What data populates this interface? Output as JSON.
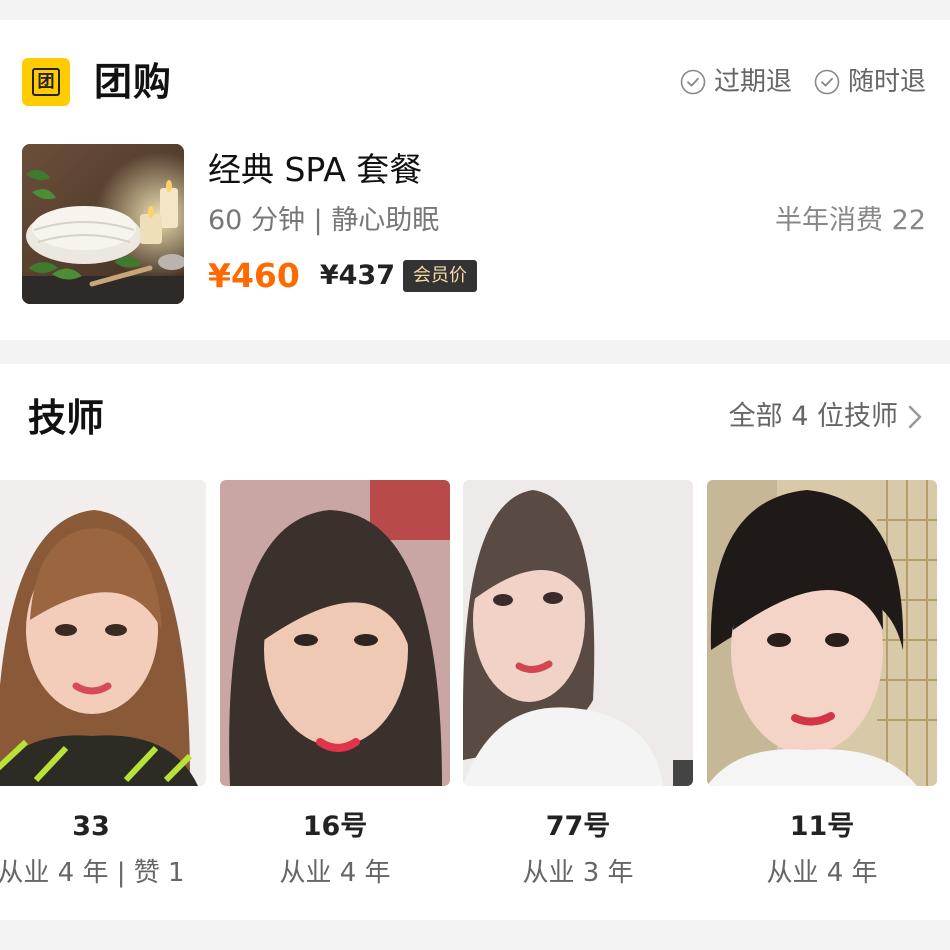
{
  "deal": {
    "logo_char": "团",
    "title": "团购",
    "guarantees": [
      "过期退",
      "随时退"
    ]
  },
  "product": {
    "name": "经典 SPA 套餐",
    "meta": "60 分钟 | 静心助眠",
    "sales": "半年消费 22",
    "price": "¥460",
    "member_price": "¥437",
    "member_label": "会员价"
  },
  "technicians": {
    "title": "技师",
    "all_link": "全部 4 位技师",
    "items": [
      {
        "number": "33",
        "experience": "从业 4 年 | 赞 1"
      },
      {
        "number": "16号",
        "experience": "从业 4 年"
      },
      {
        "number": "77号",
        "experience": "从业 3 年"
      },
      {
        "number": "11号",
        "experience": "从业 4 年"
      }
    ]
  },
  "colors": {
    "accent_yellow": "#ffcc00",
    "price_orange": "#ff6a00",
    "badge_dark": "#333333"
  },
  "icons": [
    "check-circle-icon",
    "chevron-right-icon"
  ]
}
